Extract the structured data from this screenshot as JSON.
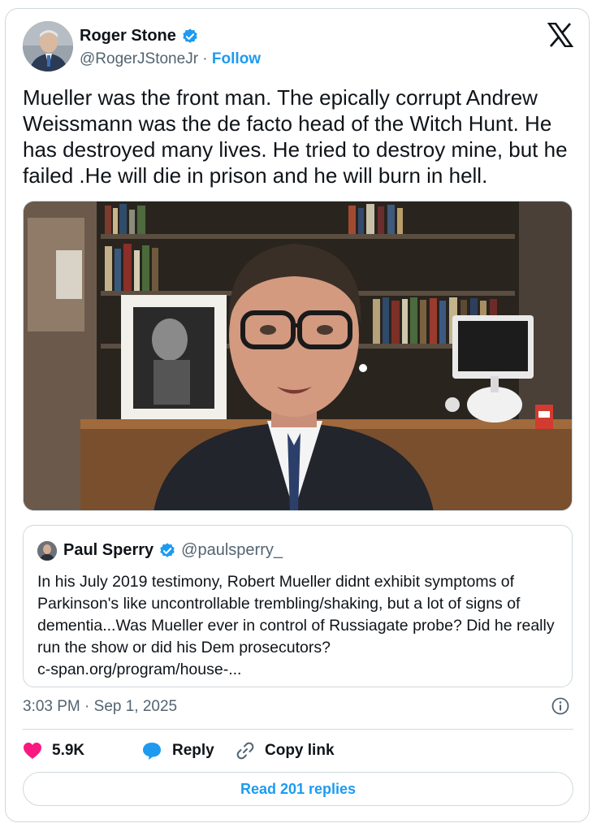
{
  "author": {
    "name": "Roger Stone",
    "handle": "@RogerJStoneJr",
    "separator": " · ",
    "follow_label": "Follow"
  },
  "tweet": {
    "text": "Mueller was the front man. The epically corrupt Andrew Weissmann was the de facto head of the Witch Hunt. He has destroyed many lives. He tried to destroy mine, but he failed .He will die in prison and he will burn in hell."
  },
  "quote": {
    "name": "Paul Sperry",
    "handle": "@paulsperry_",
    "text": "In his July 2019 testimony, Robert Mueller didnt exhibit symptoms of Parkinson's like uncontrollable trembling/shaking, but a lot of signs of dementia...Was Mueller ever in control of Russiagate probe? Did he really run the show or did his Dem prosecutors?",
    "link": "c-span.org/program/house-..."
  },
  "meta": {
    "timestamp": "3:03 PM · Sep 1, 2025"
  },
  "actions": {
    "likes": "5.9K",
    "reply_label": "Reply",
    "copy_link_label": "Copy link"
  },
  "footer": {
    "read_replies_label": "Read 201 replies"
  },
  "icons": {
    "verified": "verified-badge-icon",
    "x_logo": "x-logo-icon",
    "info": "info-icon",
    "heart": "heart-icon",
    "reply": "reply-bubble-icon",
    "link": "link-icon"
  },
  "colors": {
    "accent": "#1d9bf0",
    "heart": "#f91880",
    "text_secondary": "#536471",
    "border": "#cfd9de"
  }
}
